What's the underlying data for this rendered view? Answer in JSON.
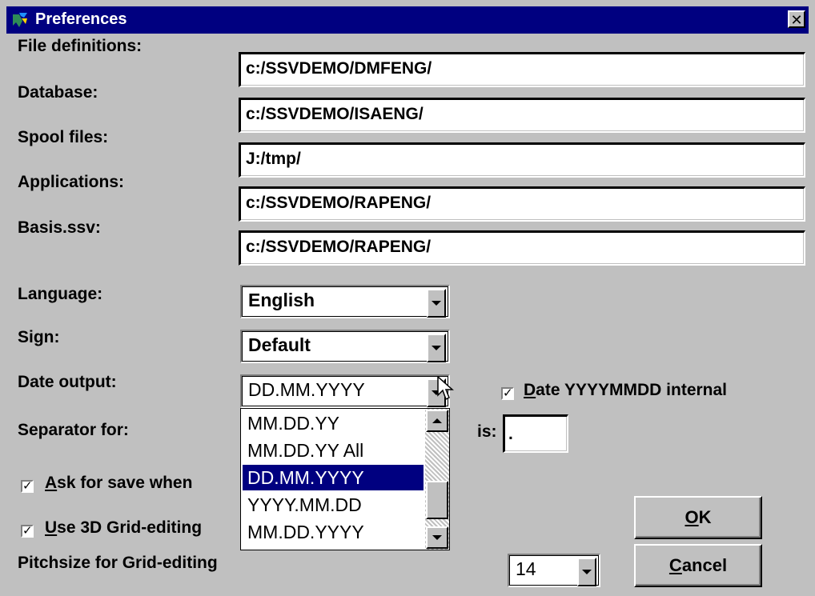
{
  "window": {
    "title": "Preferences",
    "close_glyph": "✕"
  },
  "paths": [
    {
      "label": "File definitions:",
      "value": "c:/SSVDEMO/DMFENG/"
    },
    {
      "label": "Database:",
      "value": "c:/SSVDEMO/ISAENG/"
    },
    {
      "label": "Spool files:",
      "value": "J:/tmp/"
    },
    {
      "label": "Applications:",
      "value": "c:/SSVDEMO/RAPENG/"
    },
    {
      "label": "Basis.ssv:",
      "value": "c:/SSVDEMO/RAPENG/"
    }
  ],
  "language": {
    "label": "Language:",
    "value": "English"
  },
  "sign": {
    "label": "Sign:",
    "value": "Default"
  },
  "date_output": {
    "label": "Date output:",
    "value": "DD.MM.YYYY",
    "options": [
      "MM.DD.YY",
      "MM.DD.YY All",
      "DD.MM.YYYY",
      "YYYY.MM.DD",
      "MM.DD.YYYY"
    ],
    "selected_index": 2
  },
  "date_internal": {
    "checked": true,
    "label_u": "D",
    "label_rest": "ate YYYYMMDD internal"
  },
  "separator": {
    "label": "Separator for:",
    "is_label": "is:",
    "value": "."
  },
  "ask_save": {
    "checked": true,
    "label_u": "A",
    "label_rest": "sk for save when"
  },
  "grid3d": {
    "checked": true,
    "label_u": "U",
    "label_rest": "se 3D Grid-editing"
  },
  "pitch": {
    "label": "Pitchsize for Grid-editing",
    "value": "14"
  },
  "buttons": {
    "ok_u": "O",
    "ok_rest": "K",
    "cancel_u": "C",
    "cancel_rest": "ancel"
  },
  "check_glyph": "✓",
  "colors": {
    "title_bar": "#000080",
    "face": "#c0c0c0",
    "selection": "#000080"
  }
}
